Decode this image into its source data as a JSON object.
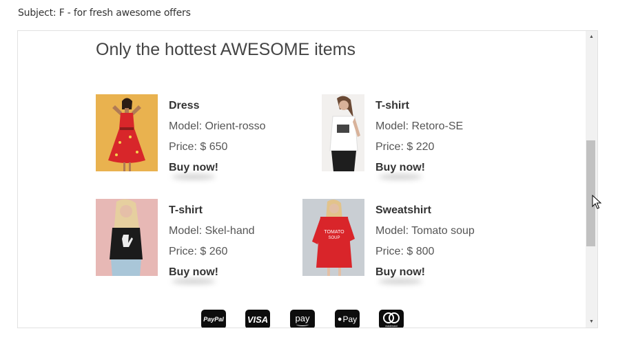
{
  "email": {
    "subject": "Subject: F - for fresh awesome offers",
    "headline": "Only the hottest AWESOME items",
    "products": [
      {
        "name": "Dress",
        "model": "Model: Orient-rosso",
        "price": "Price: $ 650",
        "cta": "Buy now!"
      },
      {
        "name": "T-shirt",
        "model": "Model: Retoro-SE",
        "price": "Price: $ 220",
        "cta": "Buy now!"
      },
      {
        "name": "T-shirt",
        "model": "Model: Skel-hand",
        "price": "Price: $ 260",
        "cta": "Buy now!"
      },
      {
        "name": "Sweatshirt",
        "model": "Model: Tomato soup",
        "price": "Price: $ 800",
        "cta": "Buy now!"
      }
    ],
    "payments": [
      {
        "label": "PayPal",
        "icon": "paypal-icon"
      },
      {
        "label": "VISA",
        "icon": "visa-icon"
      },
      {
        "label": "pay",
        "icon": "amazon-pay-icon"
      },
      {
        "label": "Pay",
        "icon": "apple-pay-icon"
      },
      {
        "label": "mastercard",
        "icon": "mastercard-icon"
      }
    ]
  },
  "colors": {
    "dress_bg": "#e9b24f",
    "dress_red": "#d8262a",
    "sweat_red": "#d9252a",
    "payment_bg": "#0d0d0d"
  }
}
